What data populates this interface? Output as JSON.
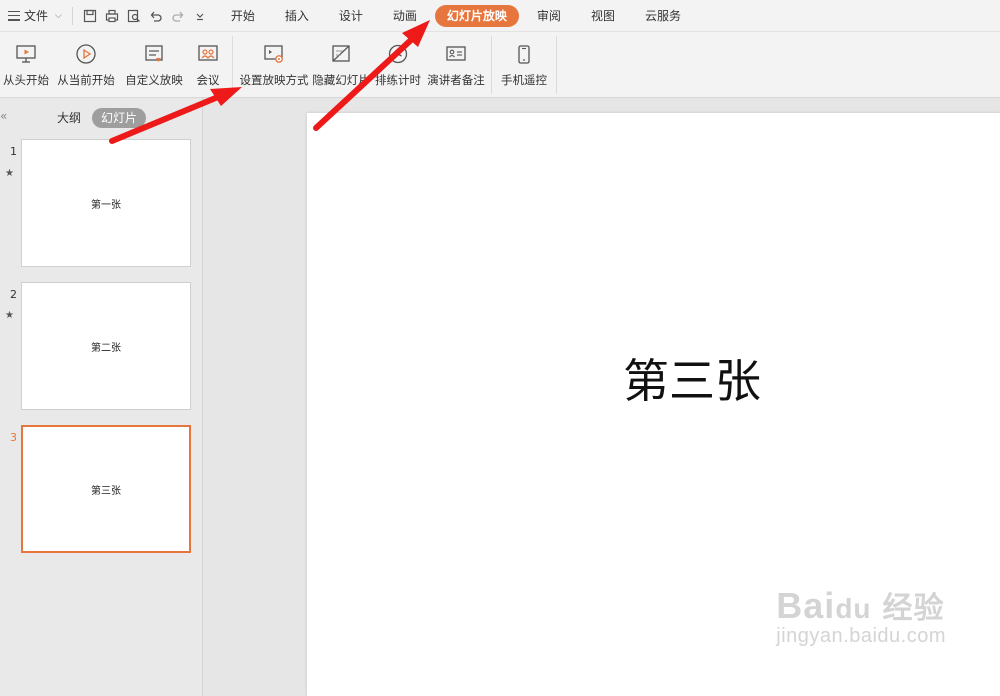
{
  "menubar": {
    "file_label": "文件",
    "tabs": [
      {
        "label": "开始",
        "active": false
      },
      {
        "label": "插入",
        "active": false
      },
      {
        "label": "设计",
        "active": false
      },
      {
        "label": "动画",
        "active": false
      },
      {
        "label": "幻灯片放映",
        "active": true
      },
      {
        "label": "审阅",
        "active": false
      },
      {
        "label": "视图",
        "active": false
      },
      {
        "label": "云服务",
        "active": false
      }
    ]
  },
  "ribbon": {
    "buttons": [
      {
        "label": "从头开始",
        "icon": "monitor-play-icon"
      },
      {
        "label": "从当前开始",
        "icon": "play-circle-icon"
      },
      {
        "label": "自定义放映",
        "icon": "custom-show-icon"
      },
      {
        "label": "会议",
        "icon": "meeting-icon"
      },
      {
        "label": "设置放映方式",
        "icon": "show-settings-icon"
      },
      {
        "label": "隐藏幻灯片",
        "icon": "hide-slide-icon"
      },
      {
        "label": "排练计时",
        "icon": "clock-icon"
      },
      {
        "label": "演讲者备注",
        "icon": "speaker-notes-icon"
      },
      {
        "label": "手机遥控",
        "icon": "phone-remote-icon"
      }
    ]
  },
  "panel": {
    "tab_outline": "大纲",
    "tab_slides": "幻灯片",
    "slides": [
      {
        "num": "1",
        "title": "第一张",
        "active": false
      },
      {
        "num": "2",
        "title": "第二张",
        "active": false
      },
      {
        "num": "3",
        "title": "第三张",
        "active": true
      }
    ]
  },
  "slide": {
    "title": "第三张"
  },
  "watermark": {
    "brand_latin": "Bai",
    "brand_paw": "du",
    "brand_cn": "经验",
    "url": "jingyan.baidu.com"
  },
  "colors": {
    "accent": "#e6763d",
    "arrow": "#ee1a1a"
  }
}
